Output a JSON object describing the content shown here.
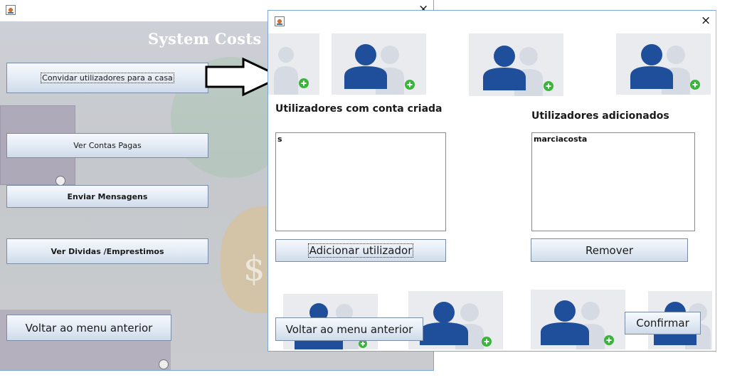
{
  "back_window": {
    "app_title": "System Costs",
    "buttons": {
      "invite": "Convidar utilizadores para a casa",
      "paid": "Ver Contas Pagas",
      "messages": "Enviar Mensagens",
      "debts": "Ver Dividas /Emprestimos",
      "back": "Voltar ao menu anterior"
    }
  },
  "front_window": {
    "close": "×",
    "created_heading": "Utilizadores com conta criada",
    "added_heading": "Utilizadores adicionados",
    "created_users": [
      "s"
    ],
    "added_users": [
      "marciacosta"
    ],
    "buttons": {
      "add": "Adicionar utilizador",
      "remove": "Remover",
      "back": "Voltar ao menu anterior",
      "confirm": "Confirmar"
    }
  },
  "colors": {
    "avatar_front": "#1f4f9a",
    "avatar_back": "#d5dae3",
    "plus_badge": "#3bb43b"
  },
  "icons": [
    "java-app-icon",
    "close-icon",
    "arrow-right-icon",
    "add-user-icon",
    "money-bag-illustration"
  ]
}
